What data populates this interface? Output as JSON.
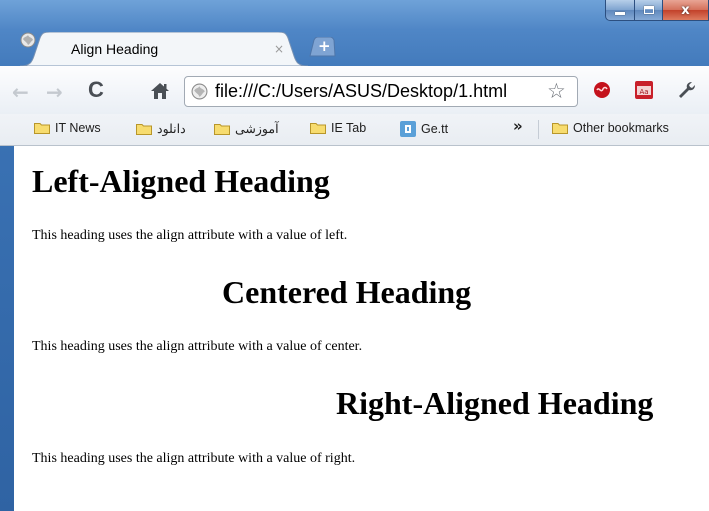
{
  "window": {
    "tab_title": "Align Heading",
    "tab_close": "×",
    "new_tab": "+",
    "close_glyph": "x"
  },
  "toolbar": {
    "back_icon": "back-arrow-icon",
    "forward_icon": "forward-arrow-icon",
    "reload": "C",
    "home": "home-icon",
    "url": "file:///C:/Users/ASUS/Desktop/1.html",
    "star": "☆"
  },
  "bookmarks": {
    "items": [
      {
        "label": "IT News"
      },
      {
        "label": "دانلود"
      },
      {
        "label": "آموزشی"
      },
      {
        "label": "IE Tab"
      },
      {
        "label": "Ge.tt"
      }
    ],
    "overflow": "»",
    "other": "Other bookmarks"
  },
  "page": {
    "heading_left": "Left-Aligned Heading",
    "para_left": "This heading uses the align attribute with a value of left.",
    "heading_center": "Centered Heading",
    "para_center": "This heading uses the align attribute with a value of center.",
    "heading_right": "Right-Aligned Heading",
    "para_right": "This heading uses the align attribute with a value of right."
  }
}
